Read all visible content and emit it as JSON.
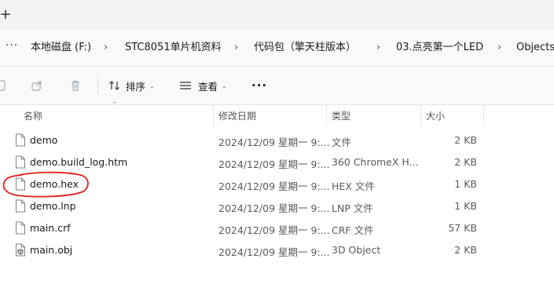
{
  "tab_bar": {
    "new_tab_label": "+"
  },
  "breadcrumb": {
    "more_label": "···",
    "items": [
      {
        "label": "本地磁盘 (F:)"
      },
      {
        "label": "STC8051单片机资料"
      },
      {
        "label": "代码包（擎天柱版本）"
      },
      {
        "label": "03.点亮第一个LED"
      },
      {
        "label": "Objects"
      }
    ],
    "separator": "›"
  },
  "toolbar": {
    "sort_label": "排序",
    "view_label": "查看",
    "more_label": "···"
  },
  "columns": {
    "name": "名称",
    "date": "修改日期",
    "type": "类型",
    "size": "大小"
  },
  "files": [
    {
      "name": "demo",
      "date": "2024/12/09 星期一 9:...",
      "type": "文件",
      "size": "2 KB",
      "icon": "blank-file-icon"
    },
    {
      "name": "demo.build_log.htm",
      "date": "2024/12/09 星期一 9:...",
      "type": "360 ChromeX H...",
      "size": "2 KB",
      "icon": "blank-file-icon"
    },
    {
      "name": "demo.hex",
      "date": "2024/12/09 星期一 9:...",
      "type": "HEX 文件",
      "size": "1 KB",
      "icon": "blank-file-icon"
    },
    {
      "name": "demo.lnp",
      "date": "2024/12/09 星期一 9:...",
      "type": "LNP 文件",
      "size": "1 KB",
      "icon": "blank-file-icon"
    },
    {
      "name": "main.crf",
      "date": "2024/12/09 星期一 9:...",
      "type": "CRF 文件",
      "size": "57 KB",
      "icon": "blank-file-icon"
    },
    {
      "name": "main.obj",
      "date": "2024/12/09 星期一 9:...",
      "type": "3D Object",
      "size": "2 KB",
      "icon": "3d-object-icon"
    }
  ],
  "colors": {
    "annotation": "#e0201b",
    "toolbar_bg": "#f9f9f9",
    "icon_gray": "#9aa0a6"
  }
}
